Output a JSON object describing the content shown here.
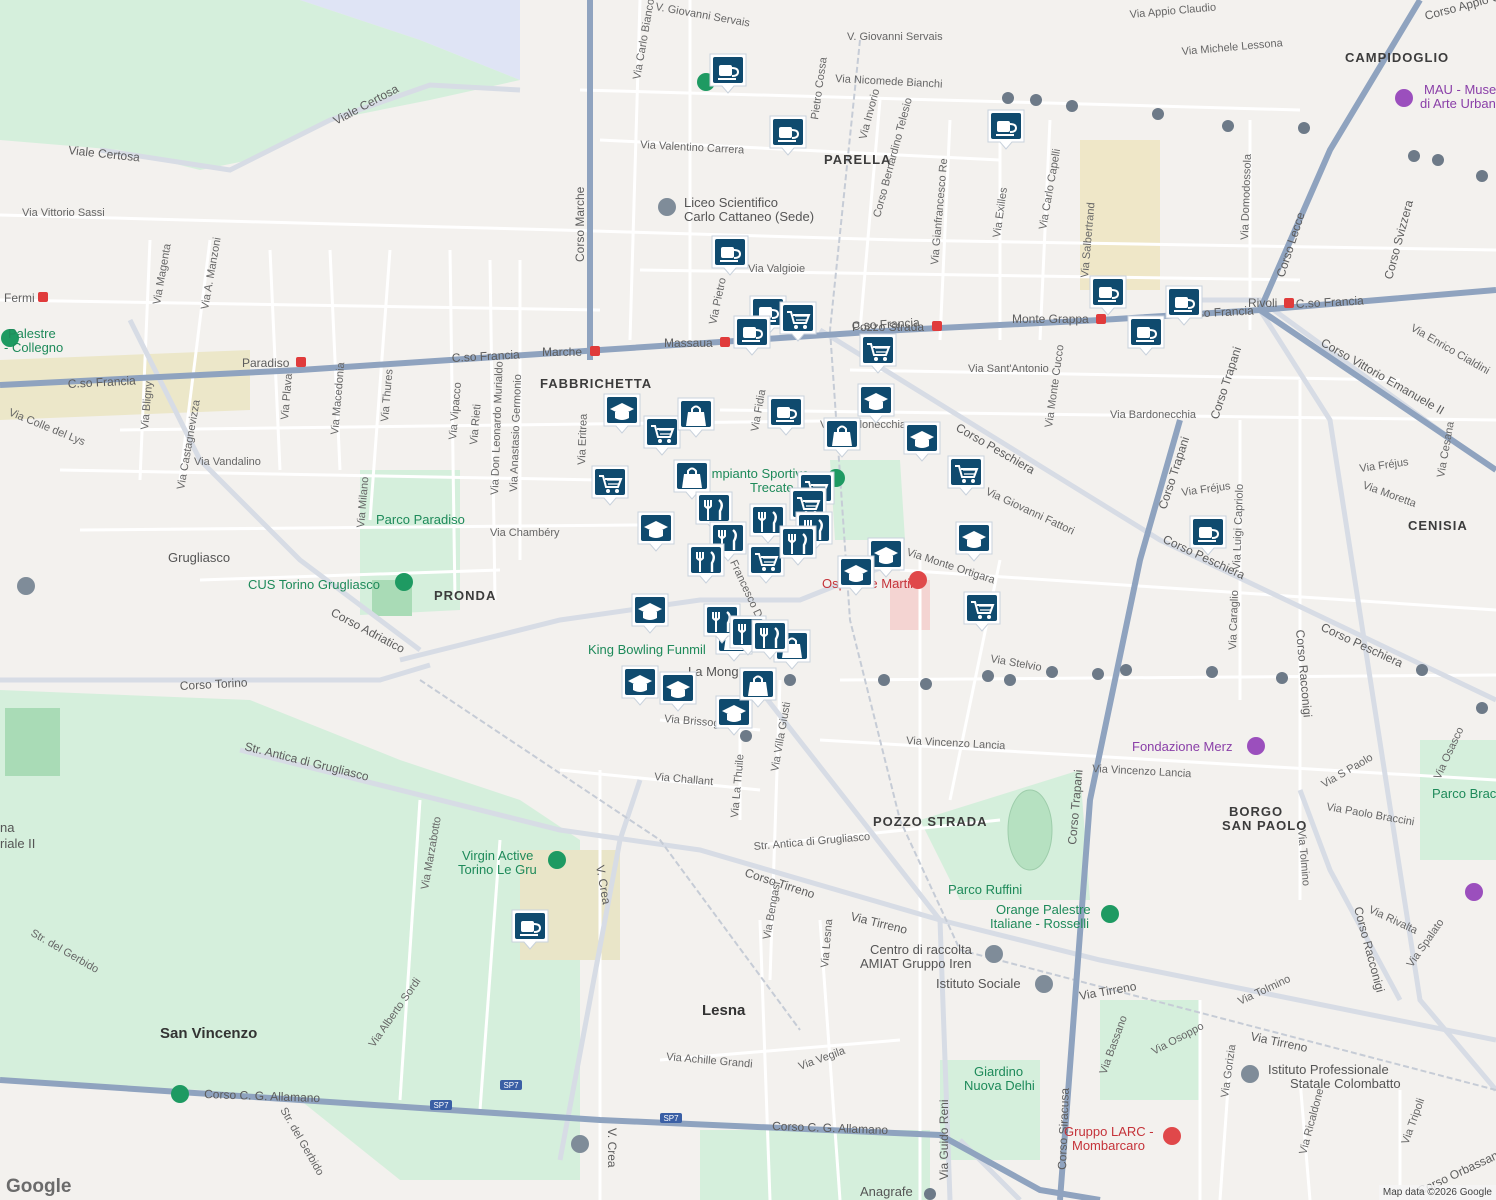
{
  "map": {
    "areas": [
      {
        "name": "FABBRICHETTA",
        "kind": "area"
      },
      {
        "name": "PARELLA",
        "kind": "area"
      },
      {
        "name": "CAMPIDOGLIO",
        "kind": "area"
      },
      {
        "name": "PRONDA",
        "kind": "area"
      },
      {
        "name": "CENISIA",
        "kind": "area"
      },
      {
        "name": "POZZO STRADA",
        "kind": "area"
      },
      {
        "name": "BORGO",
        "kind": "area"
      },
      {
        "name": "SAN PAOLO",
        "kind": "area"
      },
      {
        "name": "San Vincenzo",
        "kind": "town"
      },
      {
        "name": "Lesna",
        "kind": "town"
      },
      {
        "name": "Grugliasco",
        "kind": "town"
      }
    ],
    "streets": [
      "Viale Certosa",
      "Viale Certosa",
      "Via Vittorio Sassi",
      "Via Magenta",
      "Via A. Manzoni",
      "Via Bligny",
      "Via Castagnevizza",
      "Via Colle del Lys",
      "Via Vandalino",
      "Via Plava",
      "Via Macedonia",
      "Via Thures",
      "Via Milano",
      "Via Vipacco",
      "Via Rieti",
      "Via Don Leonardo Murialdo",
      "Via Anastasio Germonio",
      "Via Eritrea",
      "Via Chambéry",
      "C.so Francia",
      "C.so Francia",
      "Corso Marche",
      "Corso Torino",
      "Corso Adriatico",
      "Str. Antica di Grugliasco",
      "Via Marzabotto",
      "Str. del Gerbido",
      "Via Alberto Sordi",
      "Corso C. G. Allamano",
      "Corso C. G. Allamano",
      "Str. del Gerbido",
      "V. Crea",
      "V. Crea",
      "Via Carlo Bianco",
      "V. Giovanni Servais",
      "V. Giovanni Servais",
      "Via Nicomede Bianchi",
      "Via Valentino Carrera",
      "Via Valgioie",
      "C.so Francia",
      "Via Sant'Antonio",
      "Via Bardonecchia",
      "Corso Peschiera",
      "Corso Peschiera",
      "Corso Peschiera",
      "Via Giovanni Fattori",
      "Via Monte Ortigara",
      "Via Stelvio",
      "Via Vincenzo Lancia",
      "Via Vincenzo Lancia",
      "Via Challant",
      "Via Brissogne",
      "Via La Thuile",
      "Via Villa Giusti",
      "Str. Antica di Grugliasco",
      "Corso Tirreno",
      "Via Tirreno",
      "Via Tirreno",
      "Via Tirreno",
      "Via Bengasi",
      "Via Lesna",
      "Via Achille Grandi",
      "Via Vegila",
      "Via Guido Reni",
      "Corso Siracusa",
      "Corso Trapani",
      "Corso Trapani",
      "Via Bassano",
      "Via Osoppo",
      "Via Gorizia",
      "Via Ricaldone",
      "Via Tripoli",
      "Corso Orbassano",
      "Via Tolmino",
      "Via Spalato",
      "Via Rivalta",
      "Corso Racconigi",
      "Corso Racconigi",
      "Via Tolmino",
      "Via Paolo Braccini",
      "Via S Paolo",
      "Via Osasco",
      "Via Caraglio",
      "Via Luigi Capriolo",
      "Via Fréjus",
      "Via Fréjus",
      "Via Moretta",
      "Via Cesana",
      "Corso Svizzera",
      "Corso Lecce",
      "Via Domodossola",
      "Via Salbertrand",
      "Via Michele Lessona",
      "Corso Appio Claudio",
      "Via Enrico Cialdini",
      "Corso Vittorio Emanuele II",
      "Via Exilles",
      "Via Carlo Capelli",
      "Via Monte Cucco",
      "Via Gianfrancesco Re",
      "Corso Bernardino Telesio",
      "Via Invorio",
      "Pietro Cossa",
      "Via Pietro",
      "C.so Francia",
      "C.so Francia",
      "Via Appio Claudio",
      "Via Bardonecchia",
      "Via Francesco D",
      "Via Fidia",
      "Corso Trapani"
    ],
    "metro_stations": [
      "Fermi",
      "Paradiso",
      "Marche",
      "Massaua",
      "Pozzo Strada",
      "Monte Grappa",
      "Rivoli"
    ],
    "places": [
      {
        "name": "Liceo Scientifico",
        "color": "grey"
      },
      {
        "name": "Carlo Cattaneo (Sede)",
        "color": "grey"
      },
      {
        "name": "Palestre",
        "color": "green"
      },
      {
        "name": "- Collegno",
        "color": "green"
      },
      {
        "name": "CUS Torino Grugliasco",
        "color": "green"
      },
      {
        "name": "Parco Paradiso",
        "color": "green"
      },
      {
        "name": "Impianto Sportivo",
        "color": "green"
      },
      {
        "name": "Trecate",
        "color": "green"
      },
      {
        "name": "King Bowling Funmil",
        "color": "green"
      },
      {
        "name": "Virgin Active",
        "color": "green"
      },
      {
        "name": "Torino Le Gru",
        "color": "green"
      },
      {
        "name": "Parco Ruffini",
        "color": "green"
      },
      {
        "name": "Orange Palestre",
        "color": "green"
      },
      {
        "name": "Italiane - Rosselli",
        "color": "green"
      },
      {
        "name": "Centro di raccolta",
        "color": "grey"
      },
      {
        "name": "AMIAT Gruppo Iren",
        "color": "grey"
      },
      {
        "name": "Istituto Sociale",
        "color": "grey"
      },
      {
        "name": "Giardino",
        "color": "green"
      },
      {
        "name": "Nuova Delhi",
        "color": "green"
      },
      {
        "name": "Istituto Professionale",
        "color": "grey"
      },
      {
        "name": "Statale Colombatto",
        "color": "grey"
      },
      {
        "name": "Gruppo LARC -",
        "color": "red"
      },
      {
        "name": "Mombarcaro",
        "color": "red"
      },
      {
        "name": "Ospedale Martini",
        "color": "red"
      },
      {
        "name": "Fondazione Merz",
        "color": "purple"
      },
      {
        "name": "MAU - Museo",
        "color": "purple"
      },
      {
        "name": "di Arte Urbana",
        "color": "purple"
      },
      {
        "name": "Parco Brac",
        "color": "green"
      },
      {
        "name": "Anagrafe",
        "color": "grey"
      },
      {
        "name": "na",
        "color": "grey"
      },
      {
        "name": "riale II",
        "color": "grey"
      },
      {
        "name": "La Mong",
        "color": "grey"
      }
    ],
    "markers": [
      {
        "icon": "coffee"
      },
      {
        "icon": "coffee"
      },
      {
        "icon": "coffee"
      },
      {
        "icon": "coffee"
      },
      {
        "icon": "coffee"
      },
      {
        "icon": "coffee"
      },
      {
        "icon": "coffee"
      },
      {
        "icon": "coffee"
      },
      {
        "icon": "coffee"
      },
      {
        "icon": "coffee"
      },
      {
        "icon": "coffee"
      },
      {
        "icon": "coffee"
      },
      {
        "icon": "cart"
      },
      {
        "icon": "cart"
      },
      {
        "icon": "cart"
      },
      {
        "icon": "cart"
      },
      {
        "icon": "cart"
      },
      {
        "icon": "cart"
      },
      {
        "icon": "cart"
      },
      {
        "icon": "cart"
      },
      {
        "icon": "cart"
      },
      {
        "icon": "graduation"
      },
      {
        "icon": "graduation"
      },
      {
        "icon": "graduation"
      },
      {
        "icon": "graduation"
      },
      {
        "icon": "graduation"
      },
      {
        "icon": "graduation"
      },
      {
        "icon": "graduation"
      },
      {
        "icon": "graduation"
      },
      {
        "icon": "graduation"
      },
      {
        "icon": "graduation"
      },
      {
        "icon": "graduation"
      },
      {
        "icon": "bag"
      },
      {
        "icon": "bag"
      },
      {
        "icon": "bag"
      },
      {
        "icon": "bag"
      },
      {
        "icon": "bag"
      },
      {
        "icon": "bag"
      },
      {
        "icon": "fork-knife"
      },
      {
        "icon": "fork-knife"
      },
      {
        "icon": "fork-knife"
      },
      {
        "icon": "fork-knife"
      },
      {
        "icon": "fork-knife"
      },
      {
        "icon": "fork-knife"
      },
      {
        "icon": "fork-knife"
      },
      {
        "icon": "fork-knife"
      },
      {
        "icon": "fork-knife"
      }
    ],
    "road_badges": [
      "SP7",
      "SP7",
      "SP7"
    ],
    "colors": {
      "marker": "#0f4a6e",
      "park": "#c9ebd3",
      "metro": "#e03b3b",
      "main_road": "#8fa3bf"
    }
  },
  "footer": {
    "logo": "Google",
    "attribution": "Map data ©2026 Google"
  }
}
